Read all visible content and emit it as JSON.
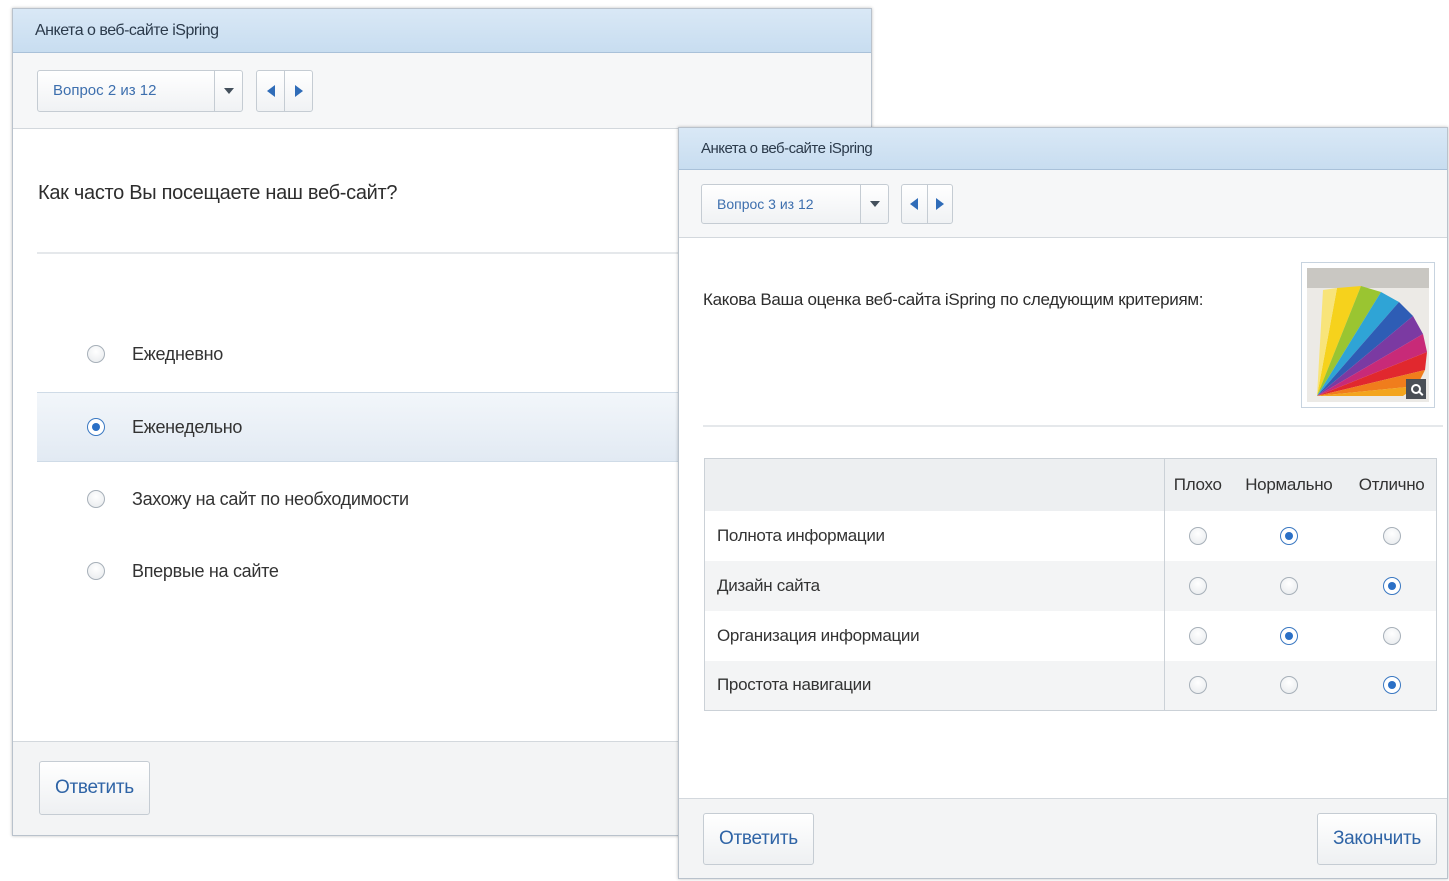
{
  "window1": {
    "title": "Анкета о веб-сайте iSpring",
    "question_selector": "Вопрос 2 из 12",
    "question": "Как часто Вы посещаете наш веб-сайт?",
    "options": [
      {
        "label": "Ежедневно",
        "selected": false
      },
      {
        "label": "Еженедельно",
        "selected": true
      },
      {
        "label": "Захожу на сайт по необходимости",
        "selected": false
      },
      {
        "label": "Впервые на сайте",
        "selected": false
      }
    ],
    "submit_label": "Ответить"
  },
  "window2": {
    "title": "Анкета о веб-сайте iSpring",
    "question_selector": "Вопрос 3 из 12",
    "question": "Какова Ваша оценка веб-сайта iSpring по следующим критериям:",
    "columns": [
      "Плохо",
      "Нормально",
      "Отлично"
    ],
    "rows": [
      {
        "label": "Полнота информации",
        "selected": 1
      },
      {
        "label": "Дизайн сайта",
        "selected": 2
      },
      {
        "label": "Организация информации",
        "selected": 1
      },
      {
        "label": "Простота навигации",
        "selected": 2
      }
    ],
    "submit_label": "Ответить",
    "finish_label": "Закончить"
  },
  "icons": {
    "dropdown": "chevron-down-icon",
    "prev": "arrow-left-icon",
    "next": "arrow-right-icon",
    "zoom": "magnifier-icon"
  },
  "colors": {
    "titlebar": "#cfe1f3",
    "accent": "#2f6cb8",
    "selected_row": "#e6edf5"
  }
}
